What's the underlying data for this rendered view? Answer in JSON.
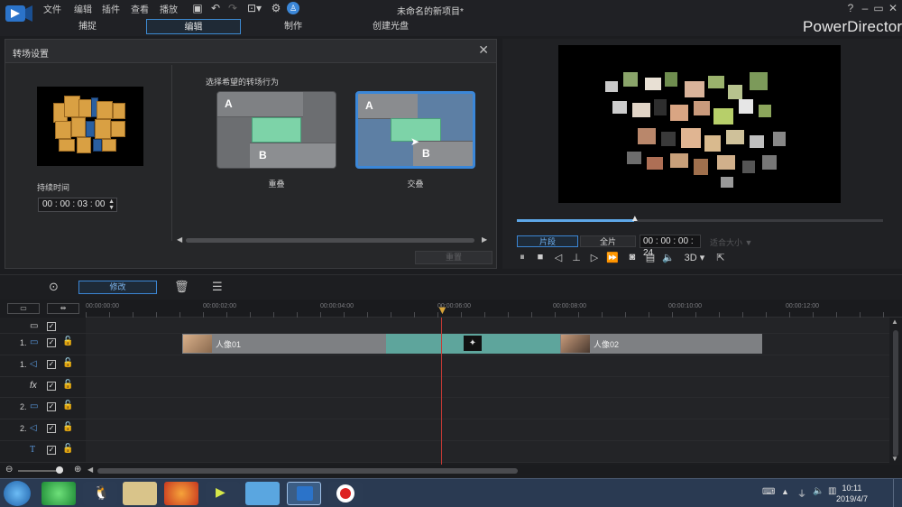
{
  "app": {
    "brand": "PowerDirector",
    "document_title": "未命名的新项目*",
    "menus": [
      "文件",
      "编辑",
      "插件",
      "查看",
      "播放"
    ],
    "mode_tabs": [
      "捕捉",
      "编辑",
      "制作",
      "创建光盘"
    ],
    "active_mode": "编辑",
    "window_controls": [
      "?",
      "–",
      "▭",
      "✕"
    ]
  },
  "dialog": {
    "title": "转场设置",
    "duration_label": "持续时间",
    "duration_value": "00 : 00 : 03 : 00",
    "choose_label": "选择希望的转场行为",
    "options": [
      {
        "label": "重叠",
        "a": "A",
        "b": "B",
        "selected": false
      },
      {
        "label": "交叠",
        "a": "A",
        "b": "B",
        "selected": true
      }
    ],
    "apply_button": "重置"
  },
  "player": {
    "progress": 0.32,
    "clip_button": "片段",
    "full_button": "全片",
    "timecode": "00 : 00 : 00 : 24",
    "zoom_label": "适合大小"
  },
  "timeline": {
    "edit_button": "修改",
    "ruler_labels": [
      "00:00:00:00",
      "00:00:02:00",
      "00:00:04:00",
      "00:00:06:00",
      "00:00:08:00",
      "00:00:10:00",
      "00:00:12:00"
    ],
    "tracks": [
      {
        "num": "",
        "kind": "master",
        "icon": "track-icon"
      },
      {
        "num": "1.",
        "kind": "video",
        "icon": "video-track-icon"
      },
      {
        "num": "1.",
        "kind": "audio",
        "icon": "audio-track-icon"
      },
      {
        "num": "",
        "kind": "fx",
        "icon": "fx-icon"
      },
      {
        "num": "2.",
        "kind": "video",
        "icon": "video-track-icon"
      },
      {
        "num": "2.",
        "kind": "audio",
        "icon": "audio-track-icon"
      },
      {
        "num": "",
        "kind": "title",
        "icon": "title-track-icon"
      }
    ],
    "clips": [
      {
        "name": "人像01"
      },
      {
        "name": "人像02"
      }
    ]
  },
  "taskbar": {
    "time": "10:11",
    "date": "2019/4/7"
  },
  "colors": {
    "accent": "#3d8ad1",
    "transition": "#7dd3a8",
    "playhead": "#c43a34"
  }
}
